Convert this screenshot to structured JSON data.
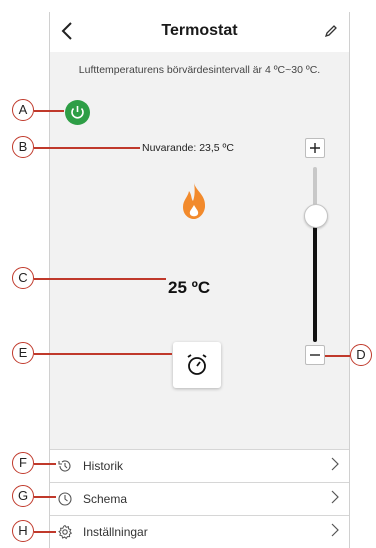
{
  "header": {
    "title": "Termostat",
    "back_icon": "chevron-left-icon",
    "edit_icon": "pencil-icon"
  },
  "info_text": "Lufttemperaturens börvärdesintervall är 4 ºC~30 ºC.",
  "current_temperature": "Nuvarande: 23,5 ºC",
  "setpoint": "25 ºC",
  "slider": {
    "plus_label": "+",
    "minus_label": "−",
    "level_fraction": 0.8
  },
  "menu": [
    {
      "label": "Historik",
      "icon": "history-icon"
    },
    {
      "label": "Schema",
      "icon": "schedule-icon"
    },
    {
      "label": "Inställningar",
      "icon": "gear-icon"
    }
  ],
  "callouts": {
    "a": "A",
    "b": "B",
    "c": "C",
    "d": "D",
    "e": "E",
    "f": "F",
    "g": "G",
    "h": "H"
  },
  "colors": {
    "power": "#2e9e46",
    "flame": "#f28a2c",
    "callout": "#c0392b"
  }
}
